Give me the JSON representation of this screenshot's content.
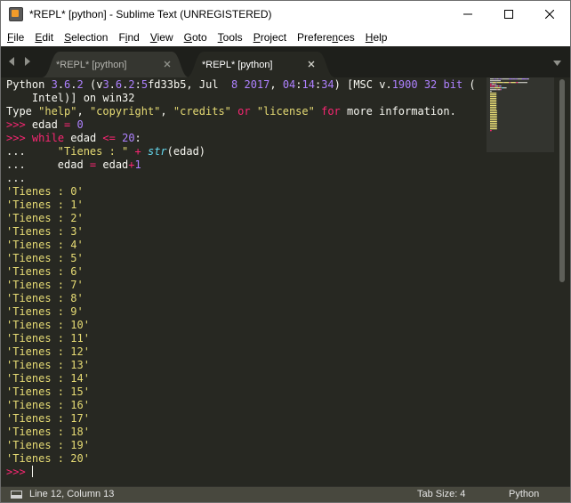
{
  "window": {
    "title": "*REPL* [python] - Sublime Text (UNREGISTERED)"
  },
  "menu": [
    {
      "u": "F",
      "rest": "ile"
    },
    {
      "u": "E",
      "rest": "dit"
    },
    {
      "u": "S",
      "rest": "election"
    },
    {
      "pre": "F",
      "u": "i",
      "rest": "nd"
    },
    {
      "u": "V",
      "rest": "iew"
    },
    {
      "u": "G",
      "rest": "oto"
    },
    {
      "u": "T",
      "rest": "ools"
    },
    {
      "u": "P",
      "rest": "roject"
    },
    {
      "pre": "Prefere",
      "u": "n",
      "rest": "ces"
    },
    {
      "u": "H",
      "rest": "elp"
    }
  ],
  "tabs": [
    {
      "label": "*REPL* [python]",
      "active": false
    },
    {
      "label": "*REPL* [python]",
      "active": true
    }
  ],
  "repl": {
    "lines": [
      [
        {
          "t": "Python "
        },
        {
          "t": "3",
          "c": "num"
        },
        {
          "t": "."
        },
        {
          "t": "6",
          "c": "num"
        },
        {
          "t": "."
        },
        {
          "t": "2",
          "c": "num"
        },
        {
          "t": " (v"
        },
        {
          "t": "3",
          "c": "num"
        },
        {
          "t": "."
        },
        {
          "t": "6",
          "c": "num"
        },
        {
          "t": "."
        },
        {
          "t": "2",
          "c": "num"
        },
        {
          "t": ":"
        },
        {
          "t": "5",
          "c": "num"
        },
        {
          "t": "fd33b5, Jul  "
        },
        {
          "t": "8",
          "c": "num"
        },
        {
          "t": " "
        },
        {
          "t": "2017",
          "c": "num"
        },
        {
          "t": ", "
        },
        {
          "t": "04",
          "c": "num"
        },
        {
          "t": ":"
        },
        {
          "t": "14",
          "c": "num"
        },
        {
          "t": ":"
        },
        {
          "t": "34",
          "c": "num"
        },
        {
          "t": ") [MSC v."
        },
        {
          "t": "1900",
          "c": "num"
        },
        {
          "t": " "
        },
        {
          "t": "32",
          "c": "num"
        },
        {
          "t": " "
        },
        {
          "t": "bit",
          "c": "num"
        },
        {
          "t": " ("
        }
      ],
      [
        {
          "t": "    Intel)] on win32"
        }
      ],
      [
        {
          "t": "Type "
        },
        {
          "t": "\"help\"",
          "c": "str"
        },
        {
          "t": ", "
        },
        {
          "t": "\"copyright\"",
          "c": "str"
        },
        {
          "t": ", "
        },
        {
          "t": "\"credits\"",
          "c": "str"
        },
        {
          "t": " "
        },
        {
          "t": "or",
          "c": "kw"
        },
        {
          "t": " "
        },
        {
          "t": "\"license\"",
          "c": "str"
        },
        {
          "t": " "
        },
        {
          "t": "for",
          "c": "kw"
        },
        {
          "t": " more information."
        }
      ],
      [
        {
          "t": ">>>",
          "c": "kw"
        },
        {
          "t": " edad "
        },
        {
          "t": "=",
          "c": "kw"
        },
        {
          "t": " "
        },
        {
          "t": "0",
          "c": "num"
        }
      ],
      [
        {
          "t": ">>>",
          "c": "kw"
        },
        {
          "t": " "
        },
        {
          "t": "while",
          "c": "kw"
        },
        {
          "t": " edad "
        },
        {
          "t": "<=",
          "c": "kw"
        },
        {
          "t": " "
        },
        {
          "t": "20",
          "c": "num"
        },
        {
          "t": ":"
        }
      ],
      [
        {
          "t": "...     "
        },
        {
          "t": "\"Tienes : \"",
          "c": "str"
        },
        {
          "t": " "
        },
        {
          "t": "+",
          "c": "kw"
        },
        {
          "t": " "
        },
        {
          "t": "str",
          "c": "fn"
        },
        {
          "t": "(edad)"
        }
      ],
      [
        {
          "t": "...     edad "
        },
        {
          "t": "=",
          "c": "kw"
        },
        {
          "t": " edad"
        },
        {
          "t": "+",
          "c": "kw"
        },
        {
          "t": "1",
          "c": "num"
        }
      ],
      [
        {
          "t": "..."
        }
      ],
      [
        {
          "t": "'Tienes : 0'",
          "c": "str"
        }
      ],
      [
        {
          "t": "'Tienes : 1'",
          "c": "str"
        }
      ],
      [
        {
          "t": "'Tienes : 2'",
          "c": "str"
        }
      ],
      [
        {
          "t": "'Tienes : 3'",
          "c": "str"
        }
      ],
      [
        {
          "t": "'Tienes : 4'",
          "c": "str"
        }
      ],
      [
        {
          "t": "'Tienes : 5'",
          "c": "str"
        }
      ],
      [
        {
          "t": "'Tienes : 6'",
          "c": "str"
        }
      ],
      [
        {
          "t": "'Tienes : 7'",
          "c": "str"
        }
      ],
      [
        {
          "t": "'Tienes : 8'",
          "c": "str"
        }
      ],
      [
        {
          "t": "'Tienes : 9'",
          "c": "str"
        }
      ],
      [
        {
          "t": "'Tienes : 10'",
          "c": "str"
        }
      ],
      [
        {
          "t": "'Tienes : 11'",
          "c": "str"
        }
      ],
      [
        {
          "t": "'Tienes : 12'",
          "c": "str"
        }
      ],
      [
        {
          "t": "'Tienes : 13'",
          "c": "str"
        }
      ],
      [
        {
          "t": "'Tienes : 14'",
          "c": "str"
        }
      ],
      [
        {
          "t": "'Tienes : 15'",
          "c": "str"
        }
      ],
      [
        {
          "t": "'Tienes : 16'",
          "c": "str"
        }
      ],
      [
        {
          "t": "'Tienes : 17'",
          "c": "str"
        }
      ],
      [
        {
          "t": "'Tienes : 18'",
          "c": "str"
        }
      ],
      [
        {
          "t": "'Tienes : 19'",
          "c": "str"
        }
      ],
      [
        {
          "t": "'Tienes : 20'",
          "c": "str"
        }
      ],
      [
        {
          "t": ">>>",
          "c": "kw"
        }
      ]
    ]
  },
  "status": {
    "position": "Line 12, Column 13",
    "tab_size": "Tab Size: 4",
    "syntax": "Python"
  },
  "colors": {
    "background": "#272822",
    "keyword": "#f92672",
    "number": "#ae81ff",
    "string": "#e6db74",
    "function": "#66d9ef"
  },
  "icons": [
    "app-icon",
    "minimize-icon",
    "maximize-icon",
    "close-icon",
    "arrow-left-icon",
    "arrow-right-icon",
    "tab-close-icon",
    "tab-dropdown-icon",
    "panel-toggle-icon"
  ]
}
